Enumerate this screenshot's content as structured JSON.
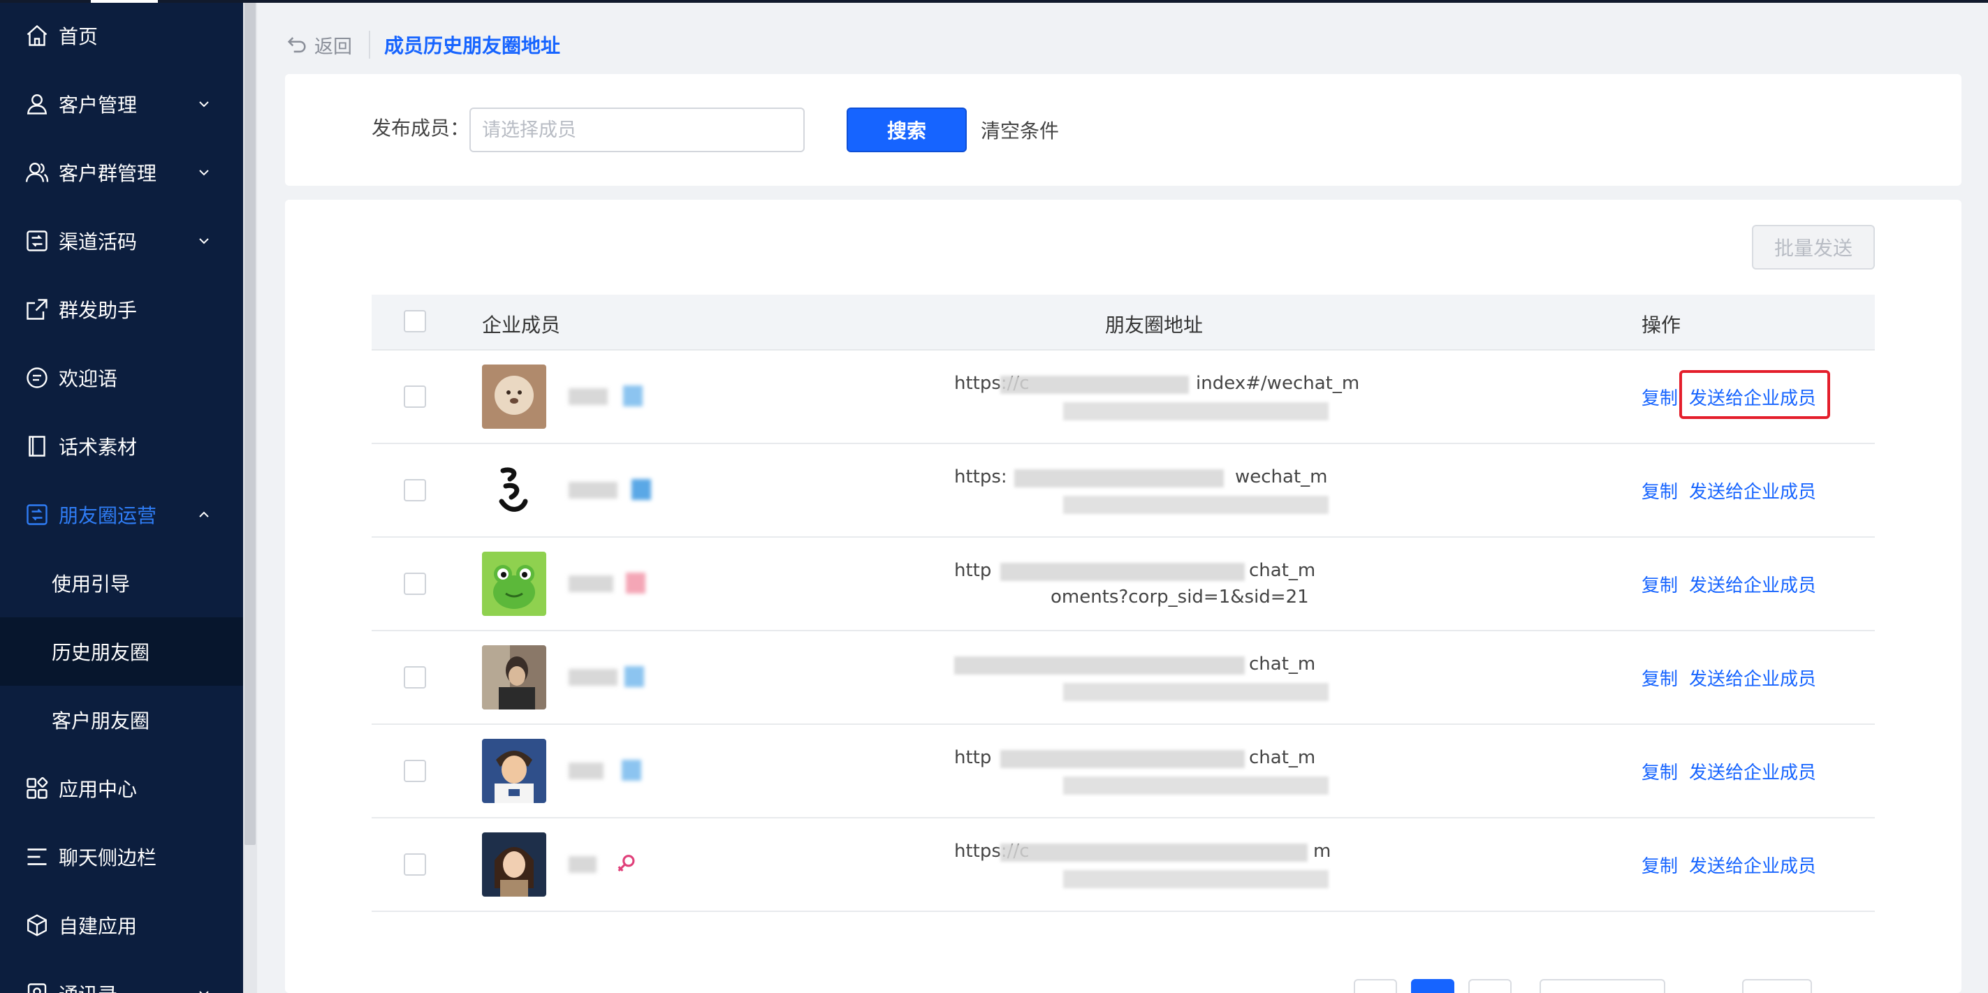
{
  "sidebar": {
    "items": [
      {
        "label": "首页",
        "icon": "home-icon",
        "has_chevron": false
      },
      {
        "label": "客户管理",
        "icon": "user-icon",
        "has_chevron": true,
        "chevron": "down"
      },
      {
        "label": "客户群管理",
        "icon": "group-icon",
        "has_chevron": true,
        "chevron": "down"
      },
      {
        "label": "渠道活码",
        "icon": "qrcode-icon",
        "has_chevron": true,
        "chevron": "down"
      },
      {
        "label": "群发助手",
        "icon": "share-icon",
        "has_chevron": false
      },
      {
        "label": "欢迎语",
        "icon": "message-icon",
        "has_chevron": false
      },
      {
        "label": "话术素材",
        "icon": "book-icon",
        "has_chevron": false
      },
      {
        "label": "朋友圈运营",
        "icon": "moments-icon",
        "has_chevron": true,
        "chevron": "up",
        "active": true
      }
    ],
    "sub_items": [
      {
        "label": "使用引导"
      },
      {
        "label": "历史朋友圈",
        "selected": true
      },
      {
        "label": "客户朋友圈"
      }
    ],
    "bottom_items": [
      {
        "label": "应用中心",
        "icon": "apps-icon"
      },
      {
        "label": "聊天侧边栏",
        "icon": "menu-lines-icon"
      },
      {
        "label": "自建应用",
        "icon": "cube-icon"
      },
      {
        "label": "通讯录",
        "icon": "contacts-icon"
      }
    ]
  },
  "header": {
    "back_label": "返回",
    "title": "成员历史朋友圈地址"
  },
  "filter": {
    "label": "发布成员：",
    "placeholder": "请选择成员",
    "value": "",
    "search_label": "搜索",
    "clear_label": "清空条件"
  },
  "table": {
    "batch_send_label": "批量发送",
    "columns": [
      "企业成员",
      "朋友圈地址",
      "操作"
    ],
    "rows": [
      {
        "url_line1": "https://c",
        "url_line1_end": "index#/wechat_m",
        "url_line2": "",
        "copy": "复制",
        "send": "发送给企业成员",
        "highlighted": true,
        "tag_color": "#8cc4f0"
      },
      {
        "url_line1": "https:",
        "url_line1_end": "wechat_m",
        "url_line2": "",
        "copy": "复制",
        "send": "发送给企业成员",
        "highlighted": false,
        "tag_color": "#5aa8e6"
      },
      {
        "url_line1": "http",
        "url_line1_end": "chat_m",
        "url_line2": "oments?corp_sid=1&sid=21",
        "copy": "复制",
        "send": "发送给企业成员",
        "highlighted": false,
        "tag_color": "#f4a6b6"
      },
      {
        "url_line1": "",
        "url_line1_end": "chat_m",
        "url_line2": "",
        "copy": "复制",
        "send": "发送给企业成员",
        "highlighted": false,
        "tag_color": "#8cc4f0"
      },
      {
        "url_line1": "http",
        "url_line1_end": "chat_m",
        "url_line2": "",
        "copy": "复制",
        "send": "发送给企业成员",
        "highlighted": false,
        "tag_color": "#8cc4f0"
      },
      {
        "url_line1": "https://c",
        "url_line1_end": "m",
        "url_line2": "",
        "copy": "复制",
        "send": "发送给企业成员",
        "highlighted": false,
        "tag_color": "#e0407a"
      }
    ]
  },
  "colors": {
    "sidebar_bg": "#0c1e3e",
    "accent": "#1664ff",
    "highlight_border": "#e41e2b"
  }
}
